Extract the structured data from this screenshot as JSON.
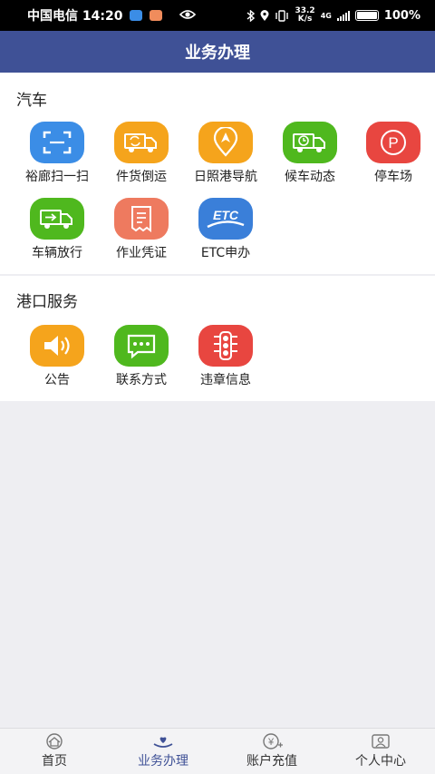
{
  "status_bar": {
    "carrier_time": "中国电信 14:20",
    "net_speed_top": "33.2",
    "net_speed_bottom": "K/s",
    "network_type": "4G",
    "battery_text": "100%",
    "battery_level": 1.0
  },
  "app_bar": {
    "title": "业务办理"
  },
  "sections": {
    "cars": {
      "title": "汽车",
      "items": [
        {
          "label": "裕廊扫一扫",
          "icon": "scan-icon",
          "color": "#3b8de6"
        },
        {
          "label": "件货倒运",
          "icon": "truck-transfer-icon",
          "color": "#f5a41c"
        },
        {
          "label": "日照港导航",
          "icon": "navigation-icon",
          "color": "#f5a41c"
        },
        {
          "label": "候车动态",
          "icon": "truck-clock-icon",
          "color": "#4fb81e"
        },
        {
          "label": "停车场",
          "icon": "parking-icon",
          "color": "#e84640"
        },
        {
          "label": "车辆放行",
          "icon": "truck-release-icon",
          "color": "#4fb81e"
        },
        {
          "label": "作业凭证",
          "icon": "receipt-icon",
          "color": "#ee7a5f"
        },
        {
          "label": "ETC申办",
          "icon": "etc-icon",
          "color": "#3a7fd9"
        }
      ]
    },
    "port": {
      "title": "港口服务",
      "items": [
        {
          "label": "公告",
          "icon": "speaker-icon",
          "color": "#f5a41c"
        },
        {
          "label": "联系方式",
          "icon": "chat-icon",
          "color": "#4fb81e"
        },
        {
          "label": "违章信息",
          "icon": "traffic-light-icon",
          "color": "#e84640"
        }
      ]
    }
  },
  "etc_text": "ETC",
  "parking_letter": "P",
  "recharge_symbol": "¥",
  "bottom_nav": [
    {
      "label": "首页",
      "icon": "home-icon"
    },
    {
      "label": "业务办理",
      "icon": "business-icon",
      "active": true
    },
    {
      "label": "账户充值",
      "icon": "recharge-icon"
    },
    {
      "label": "个人中心",
      "icon": "profile-icon"
    }
  ]
}
